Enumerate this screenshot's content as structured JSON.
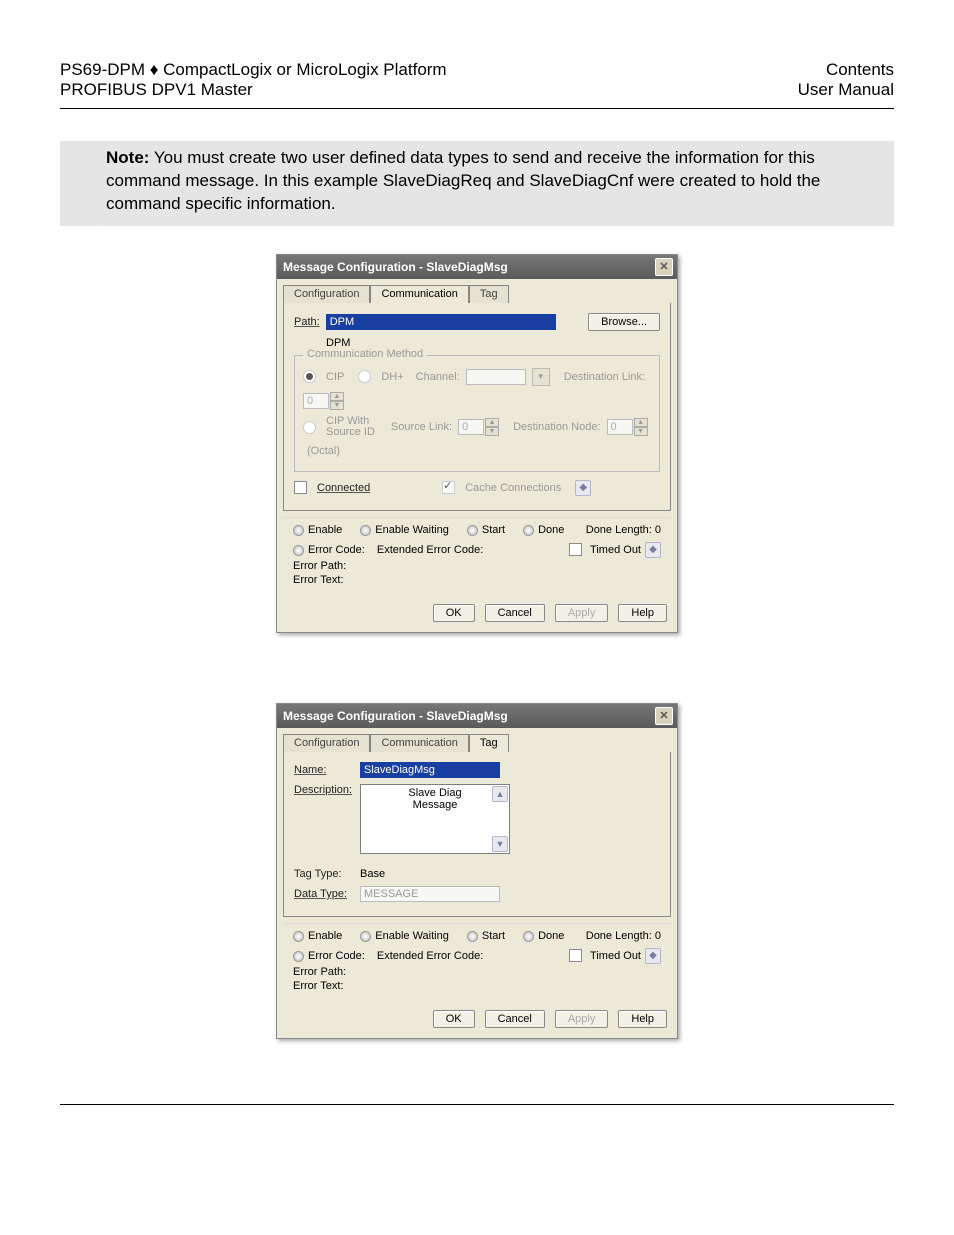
{
  "header": {
    "left_line1_a": "PS69-DPM",
    "left_line1_sep": " ♦ ",
    "left_line1_b": "CompactLogix or MicroLogix Platform",
    "left_line2": "PROFIBUS DPV1 Master",
    "right_line1": "Contents",
    "right_line2": "User Manual"
  },
  "note": {
    "label": "Note:",
    "text": " You must create two user defined data types to send and receive the information for this command message. In this example SlaveDiagReq and SlaveDiagCnf were created to hold the command specific information."
  },
  "dialog1": {
    "title": "Message Configuration - SlaveDiagMsg",
    "tabs": {
      "configuration": "Configuration",
      "communication": "Communication",
      "tag": "Tag"
    },
    "path_label": "Path:",
    "path_value": "DPM",
    "path_echo": "DPM",
    "browse": "Browse...",
    "group_title": "Communication Method",
    "cip": "CIP",
    "dhp": "DH+",
    "channel_label": "Channel:",
    "dest_link_label": "Destination Link:",
    "dest_link_value": "0",
    "cip_with_src": "CIP With\nSource ID",
    "source_link_label": "Source Link:",
    "source_link_value": "0",
    "dest_node_label": "Destination Node:",
    "dest_node_value": "0",
    "octal": "(Octal)",
    "connected_label": "Connected",
    "cache_label": "Cache Connections",
    "status": {
      "enable": "Enable",
      "enable_waiting": "Enable Waiting",
      "start": "Start",
      "done": "Done",
      "done_length_label": "Done Length:",
      "done_length_value": "0",
      "error_code": "Error Code:",
      "extended_error": "Extended Error Code:",
      "timed_out": "Timed Out",
      "error_path": "Error Path:",
      "error_text": "Error Text:"
    },
    "buttons": {
      "ok": "OK",
      "cancel": "Cancel",
      "apply": "Apply",
      "help": "Help"
    }
  },
  "dialog2": {
    "title": "Message Configuration - SlaveDiagMsg",
    "tabs": {
      "configuration": "Configuration",
      "communication": "Communication",
      "tag": "Tag"
    },
    "name_label": "Name:",
    "name_value": "SlaveDiagMsg",
    "desc_label": "Description:",
    "desc_value": "Slave Diag\nMessage",
    "tag_type_label": "Tag Type:",
    "tag_type_value": "Base",
    "data_type_label": "Data Type:",
    "data_type_value": "MESSAGE",
    "status": {
      "enable": "Enable",
      "enable_waiting": "Enable Waiting",
      "start": "Start",
      "done": "Done",
      "done_length_label": "Done Length:",
      "done_length_value": "0",
      "error_code": "Error Code:",
      "extended_error": "Extended Error Code:",
      "timed_out": "Timed Out",
      "error_path": "Error Path:",
      "error_text": "Error Text:"
    },
    "buttons": {
      "ok": "OK",
      "cancel": "Cancel",
      "apply": "Apply",
      "help": "Help"
    }
  }
}
